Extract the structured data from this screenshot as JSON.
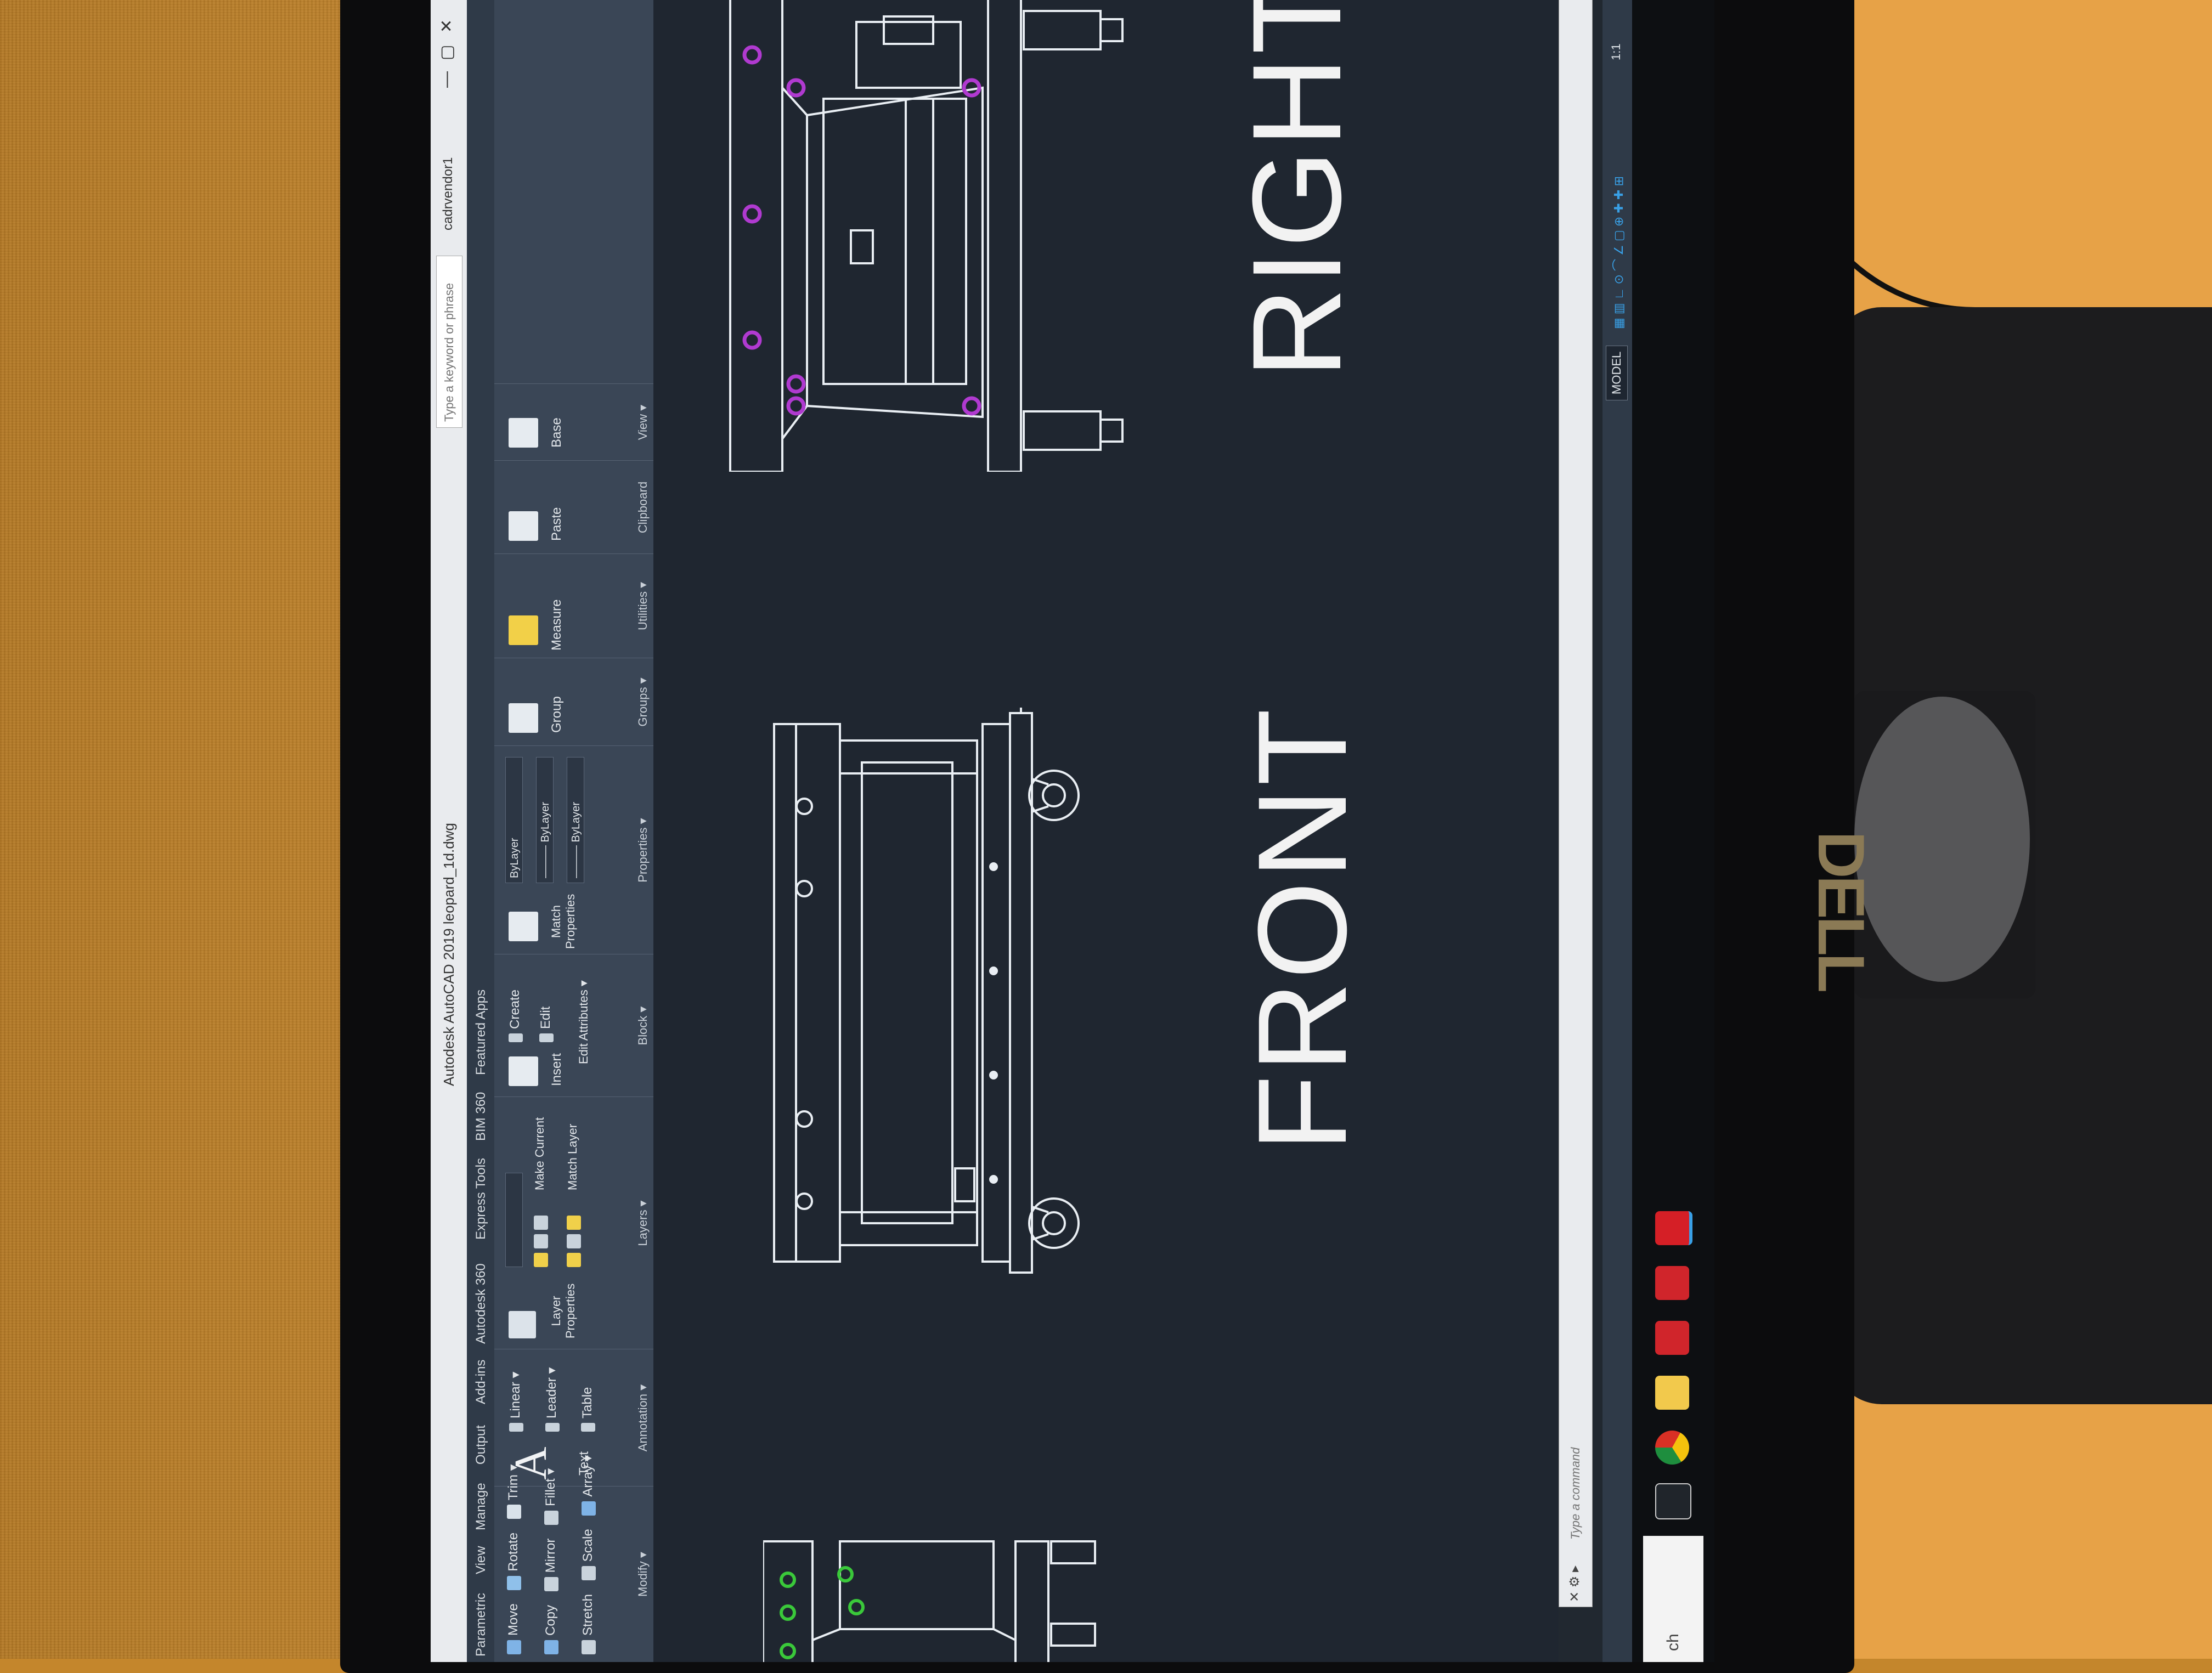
{
  "app": {
    "title": "Autodesk AutoCAD 2019   leopard_1d.dwg",
    "search_placeholder": "Type a keyword or phrase",
    "user": "cadrvendor1",
    "window_controls": [
      "—",
      "▢",
      "✕"
    ]
  },
  "menu_tabs": [
    "Parametric",
    "View",
    "Manage",
    "Output",
    "Add-ins",
    "Autodesk 360",
    "Express Tools",
    "BIM 360",
    "Featured Apps"
  ],
  "ribbon": {
    "modify": {
      "label": "Modify ▾",
      "items": [
        "Move",
        "Rotate",
        "Trim ▾",
        "Copy",
        "Mirror",
        "Fillet ▾",
        "Stretch",
        "Scale",
        "Array ▾"
      ]
    },
    "annotation": {
      "label": "Annotation ▾",
      "text_label": "Text",
      "big_glyph": "A",
      "items": [
        "Linear ▾",
        "Leader ▾",
        "Table"
      ]
    },
    "layers": {
      "label": "Layers ▾",
      "layer_properties": "Layer Properties",
      "items": [
        "Make Current",
        "Match Layer"
      ]
    },
    "block": {
      "label": "Block ▾",
      "insert": "Insert",
      "items": [
        "Create",
        "Edit",
        "Edit Attributes ▾"
      ]
    },
    "properties": {
      "label": "Properties ▾",
      "match": "Match Properties",
      "values": [
        "ByLayer",
        "——— ByLayer",
        "——— ByLayer"
      ]
    },
    "groups": {
      "label": "Groups ▾",
      "item": "Group"
    },
    "utilities": {
      "label": "Utilities ▾",
      "item": "Measure"
    },
    "clipboard": {
      "label": "Clipboard",
      "item": "Paste"
    },
    "view": {
      "label": "View ▾",
      "item": "Base"
    }
  },
  "drawing": {
    "label_front": "FRONT",
    "label_right": "RIGHT"
  },
  "command_line": {
    "placeholder": "Type a command",
    "buttons": "✕ ⚙ ▸"
  },
  "status": {
    "model": "MODEL",
    "scale": "1:1"
  },
  "taskbar": {
    "search": "ch",
    "apps": [
      "task-view",
      "chrome",
      "file-explorer",
      "solidworks",
      "solidworks",
      "autocad"
    ]
  },
  "colors": {
    "drawing_line": "#e9eef3",
    "drawing_bg": "#1f2630",
    "purple_marker": "#b03ad0",
    "green_marker": "#3ac83a",
    "accent_blue": "#39a0e6"
  },
  "monitor_brand": "DELL"
}
